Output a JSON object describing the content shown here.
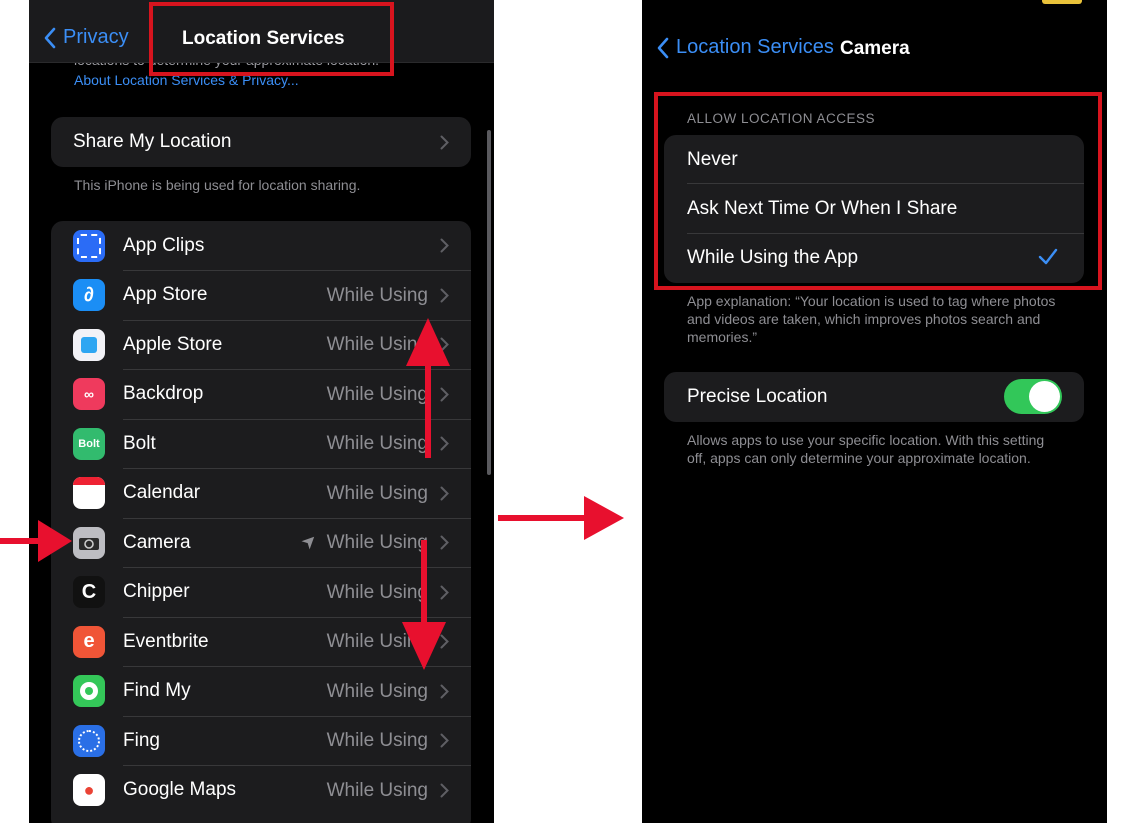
{
  "left_screen": {
    "back_label": "Privacy",
    "title": "Location Services",
    "clipped_text": "locations to determine your approximate location.",
    "about_link": "About Location Services & Privacy...",
    "share_my_location": "Share My Location",
    "share_note": "This iPhone is being used for location sharing.",
    "apps": [
      {
        "name": "App Clips",
        "value": "",
        "icon": "app-clips-icon",
        "color": "#2b6cf6"
      },
      {
        "name": "App Store",
        "value": "While Using",
        "icon": "app-store-icon",
        "color": "#1b8ef5"
      },
      {
        "name": "Apple Store",
        "value": "While Using",
        "icon": "apple-store-icon",
        "color": "#f2f2f7"
      },
      {
        "name": "Backdrop",
        "value": "While Using",
        "icon": "backdrop-icon",
        "color": "#ef3a5d"
      },
      {
        "name": "Bolt",
        "value": "While Using",
        "icon": "bolt-icon",
        "color": "#32bb6e"
      },
      {
        "name": "Calendar",
        "value": "While Using",
        "icon": "calendar-icon",
        "color": "#ffffff"
      },
      {
        "name": "Camera",
        "value": "While Using",
        "icon": "camera-icon",
        "color": "#8e8e93"
      },
      {
        "name": "Chipper",
        "value": "While Using",
        "icon": "chipper-icon",
        "color": "#111111"
      },
      {
        "name": "Eventbrite",
        "value": "While Using",
        "icon": "eventbrite-icon",
        "color": "#f05537"
      },
      {
        "name": "Find My",
        "value": "While Using",
        "icon": "find-my-icon",
        "color": "#34c759"
      },
      {
        "name": "Fing",
        "value": "While Using",
        "icon": "fing-icon",
        "color": "#2a6fe6"
      },
      {
        "name": "Google Maps",
        "value": "While Using",
        "icon": "google-maps-icon",
        "color": "#ffffff"
      }
    ],
    "app_icon_text": {
      "bolt": "Bolt",
      "eventbrite": "e"
    }
  },
  "right_screen": {
    "back_label": "Location Services",
    "title": "Camera",
    "section_header": "ALLOW LOCATION ACCESS",
    "options": [
      {
        "label": "Never",
        "selected": false
      },
      {
        "label": "Ask Next Time Or When I Share",
        "selected": false
      },
      {
        "label": "While Using the App",
        "selected": true
      }
    ],
    "explanation": "App explanation: “Your location is used to tag where photos and videos are taken, which improves photos search and memories.”",
    "precise_location_label": "Precise Location",
    "precise_location_on": true,
    "precise_note": "Allows apps to use your specific location. With this setting off, apps can only determine your approximate location."
  },
  "colors": {
    "accent": "#3b8ef5",
    "highlight_red": "#d7141e",
    "arrow_red": "#e8102e",
    "toggle_green": "#32c759"
  }
}
